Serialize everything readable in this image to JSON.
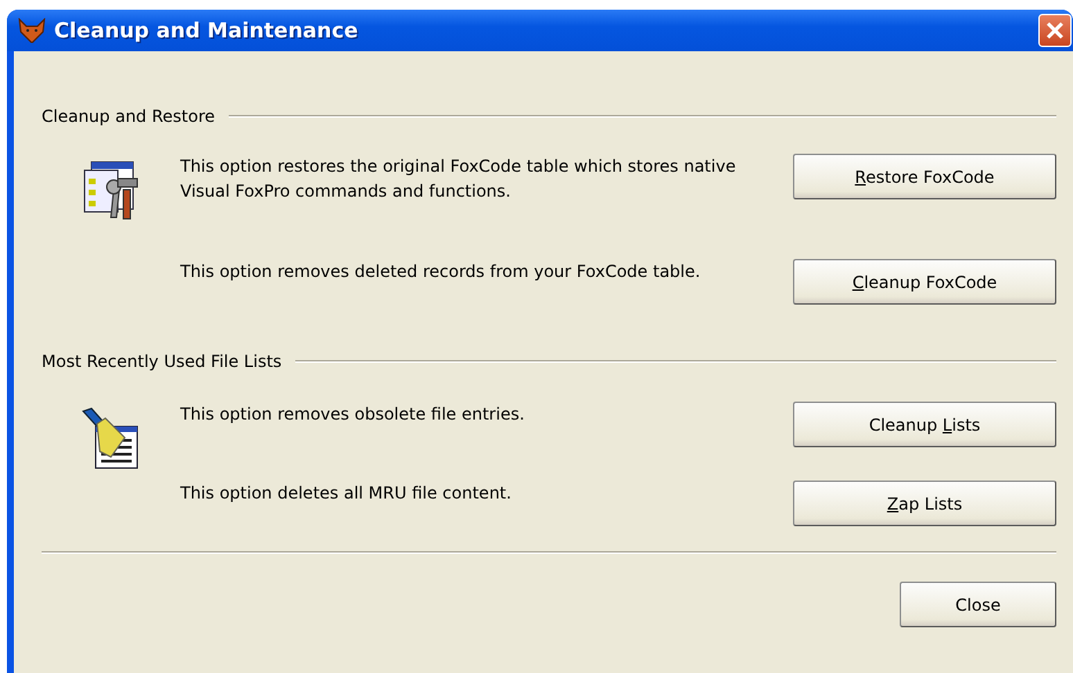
{
  "window": {
    "title": "Cleanup and Maintenance"
  },
  "sections": [
    {
      "title": "Cleanup and Restore",
      "options": [
        {
          "description": "This option restores the original FoxCode table which stores  native Visual FoxPro commands and functions.",
          "button": {
            "key": "R",
            "after": "estore FoxCode"
          }
        },
        {
          "description": "This option removes deleted records from your FoxCode table.",
          "button": {
            "key": "C",
            "after": "leanup FoxCode"
          }
        }
      ]
    },
    {
      "title": "Most Recently Used File Lists",
      "options": [
        {
          "description": "This option removes obsolete file entries.",
          "button": {
            "before": "Cleanup ",
            "key": "L",
            "after": "ists"
          }
        },
        {
          "description": "This option deletes all MRU file content.",
          "button": {
            "key": "Z",
            "after": "ap Lists"
          }
        }
      ]
    }
  ],
  "footer": {
    "button": {
      "before": "Close"
    }
  }
}
